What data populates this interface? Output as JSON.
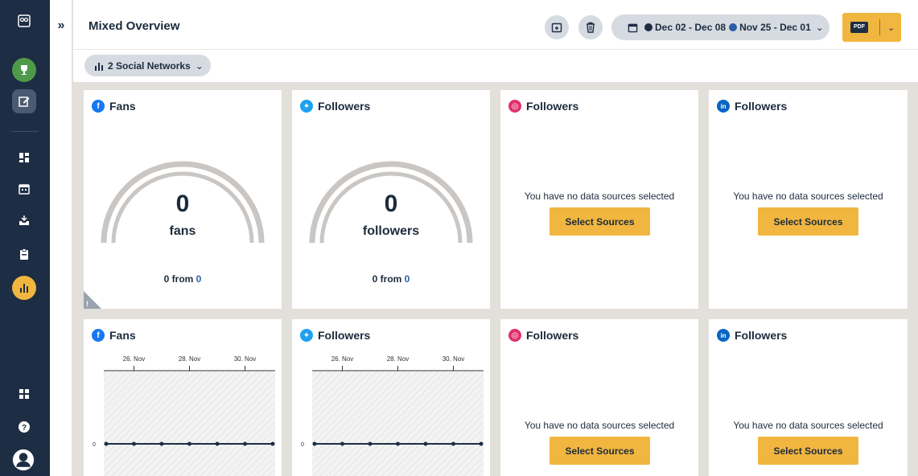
{
  "sidebar": {
    "items": [
      {
        "icon": "owl-logo-icon"
      },
      {
        "icon": "trophy-icon"
      },
      {
        "icon": "compose-icon"
      },
      {
        "icon": "dashboard-icon"
      },
      {
        "icon": "calendar-icon"
      },
      {
        "icon": "inbox-icon"
      },
      {
        "icon": "clipboard-icon"
      },
      {
        "icon": "analytics-icon"
      },
      {
        "icon": "apps-icon"
      },
      {
        "icon": "help-icon"
      },
      {
        "icon": "profile-icon"
      }
    ],
    "expand_label": "»",
    "colors": {
      "bg": "#1d2d44",
      "trophy": "#4f9a4a",
      "analytics": "#f1b63f"
    }
  },
  "header": {
    "title": "Mixed Overview",
    "date_range_primary": "Dec 02 - Dec 08",
    "date_range_compare": "Nov 25 - Dec 01",
    "caret": "⌄",
    "export_label": "PDF",
    "primary_dot_color": "#1d2d44",
    "compare_dot_color": "#2b5da8",
    "accent": "#f1b63f"
  },
  "filter": {
    "label": "2 Social Networks",
    "caret": "⌄"
  },
  "cards": {
    "fb_fans": {
      "title": "Fans",
      "network": "facebook",
      "value": "0",
      "unit": "fans",
      "from_prefix": "0 from",
      "from_value": "0",
      "warning": "!"
    },
    "tw_followers": {
      "title": "Followers",
      "network": "twitter",
      "value": "0",
      "unit": "followers",
      "from_prefix": "0 from",
      "from_value": "0"
    },
    "ig_followers": {
      "title": "Followers",
      "network": "instagram",
      "message": "You have no data sources selected",
      "button": "Select Sources"
    },
    "li_followers": {
      "title": "Followers",
      "network": "linkedin",
      "message": "You have no data sources selected",
      "button": "Select Sources"
    },
    "fb_fans_chart": {
      "title": "Fans",
      "network": "facebook"
    },
    "tw_followers_chart": {
      "title": "Followers",
      "network": "twitter"
    },
    "ig_followers_2": {
      "title": "Followers",
      "network": "instagram",
      "message": "You have no data sources selected",
      "button": "Select Sources"
    },
    "li_followers_2": {
      "title": "Followers",
      "network": "linkedin",
      "message": "You have no data sources selected",
      "button": "Select Sources"
    }
  },
  "icons": {
    "facebook": {
      "glyph": "f",
      "color": "#1877f2"
    },
    "twitter": {
      "glyph": "✦",
      "color": "#1da1f2"
    },
    "instagram": {
      "glyph": "◎",
      "color": "#e1306c"
    },
    "linkedin": {
      "glyph": "in",
      "color": "#0a66c2"
    }
  },
  "chart_data": [
    {
      "type": "line",
      "title": "Fans",
      "x": [
        "25. Nov",
        "26. Nov",
        "27. Nov",
        "28. Nov",
        "29. Nov",
        "30. Nov",
        "1. Dec"
      ],
      "x_tick_labels": [
        "26. Nov",
        "28. Nov",
        "30. Nov"
      ],
      "series": [
        {
          "values": [
            0,
            0,
            0,
            0,
            0,
            0,
            0
          ]
        }
      ],
      "y_tick_labels": [
        "0"
      ],
      "ylim": [
        0,
        1
      ],
      "grid": false
    },
    {
      "type": "line",
      "title": "Followers",
      "x": [
        "25. Nov",
        "26. Nov",
        "27. Nov",
        "28. Nov",
        "29. Nov",
        "30. Nov",
        "1. Dec"
      ],
      "x_tick_labels": [
        "26. Nov",
        "28. Nov",
        "30. Nov"
      ],
      "series": [
        {
          "values": [
            0,
            0,
            0,
            0,
            0,
            0,
            0
          ]
        }
      ],
      "y_tick_labels": [
        "0"
      ],
      "ylim": [
        0,
        1
      ],
      "grid": false
    }
  ]
}
